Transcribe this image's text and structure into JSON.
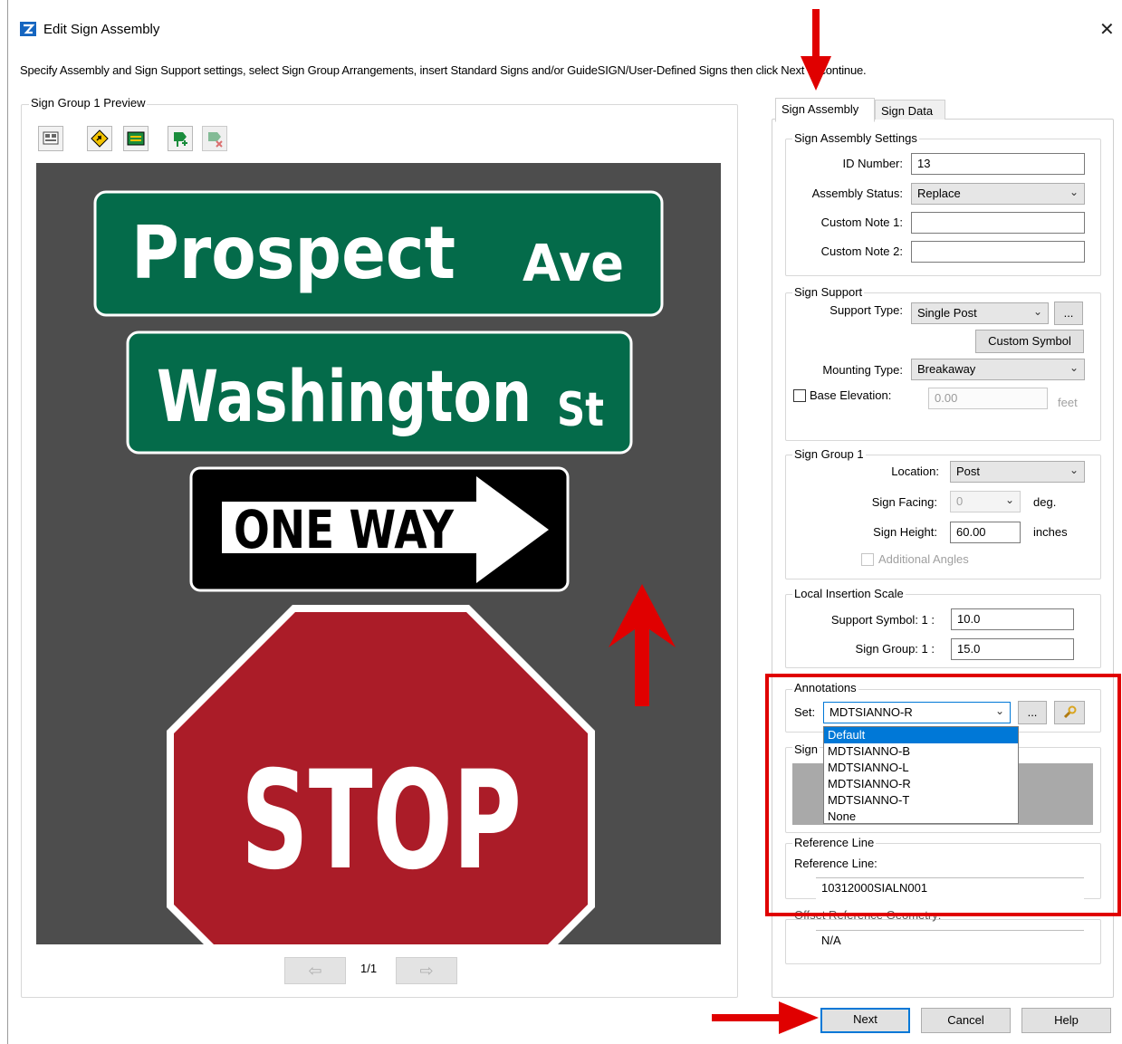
{
  "window": {
    "title": "Edit Sign Assembly",
    "close_glyph": "✕",
    "instructions": "Specify Assembly and Sign Support settings, select Sign Group Arrangements, insert Standard Signs and/or GuideSIGN/User-Defined Signs then click Next to continue."
  },
  "preview": {
    "group_label": "Sign Group 1 Preview",
    "toolbar_icons": [
      "sign-properties-icon",
      "warning-sign-icon",
      "guide-sign-icon",
      "add-sign-icon",
      "remove-sign-icon"
    ],
    "canvas_color": "#4d4d4d",
    "signs": [
      {
        "type": "street-name",
        "name": "Prospect",
        "suffix": "Ave",
        "color": "#046b4a"
      },
      {
        "type": "street-name",
        "name": "Washington",
        "suffix": "St",
        "color": "#046b4a"
      },
      {
        "type": "one-way",
        "text": "ONE WAY"
      },
      {
        "type": "stop",
        "text": "STOP",
        "color": "#ab1c28"
      }
    ],
    "pager": {
      "page": "1/1",
      "prev_glyph": "⇦",
      "next_glyph": "⇨"
    }
  },
  "tabs": [
    {
      "label": "Sign Assembly",
      "active": true
    },
    {
      "label": "Sign Data",
      "active": false
    }
  ],
  "assembly_settings": {
    "legend": "Sign Assembly Settings",
    "id_number_label": "ID Number:",
    "id_number_value": "13",
    "status_label": "Assembly Status:",
    "status_value": "Replace",
    "note1_label": "Custom Note 1:",
    "note1_value": "",
    "note2_label": "Custom Note 2:",
    "note2_value": ""
  },
  "sign_support": {
    "legend": "Sign Support",
    "support_type_label": "Support Type:",
    "support_type_value": "Single Post",
    "browse_label": "...",
    "custom_symbol_label": "Custom Symbol",
    "mounting_type_label": "Mounting Type:",
    "mounting_type_value": "Breakaway",
    "base_elevation_label": "Base Elevation:",
    "base_elevation_value": "0.00",
    "base_elevation_unit": "feet",
    "base_elevation_checked": false
  },
  "sign_group": {
    "legend": "Sign Group 1",
    "location_label": "Location:",
    "location_value": "Post",
    "facing_label": "Sign Facing:",
    "facing_value": "0",
    "facing_unit": "deg.",
    "height_label": "Sign Height:",
    "height_value": "60.00",
    "height_unit": "inches",
    "additional_angles_label": "Additional Angles"
  },
  "insertion_scale": {
    "legend": "Local Insertion Scale",
    "support_symbol_label": "Support Symbol: 1 :",
    "support_symbol_value": "10.0",
    "sign_group_label": "Sign Group: 1 :",
    "sign_group_value": "15.0"
  },
  "annotations": {
    "legend": "Annotations",
    "set_label": "Set:",
    "set_value": "MDTSIANNO-R",
    "browse_label": "...",
    "options": [
      "Default",
      "MDTSIANNO-B",
      "MDTSIANNO-L",
      "MDTSIANNO-R",
      "MDTSIANNO-T",
      "None"
    ],
    "highlighted_option": "Default",
    "hidden_group_label": "Sign"
  },
  "reference_line": {
    "legend": "Reference Line",
    "label": "Reference Line:",
    "value": "10312000SIALN001"
  },
  "offset_reference": {
    "label": "Offset Reference Geometry:",
    "value": "N/A"
  },
  "footer": {
    "next_label": "Next",
    "cancel_label": "Cancel",
    "help_label": "Help"
  },
  "annotation_colors": {
    "arrow": "#e00000",
    "highlight_box": "#e00000"
  }
}
